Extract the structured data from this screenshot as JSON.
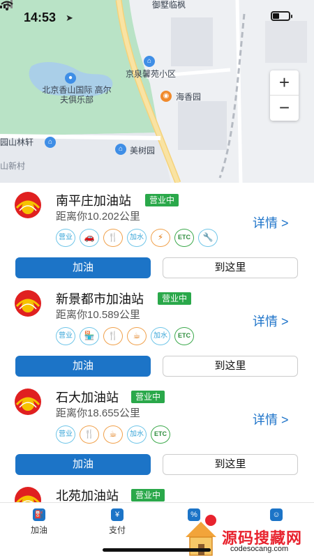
{
  "status_bar": {
    "time": "14:53"
  },
  "map": {
    "labels": {
      "top": "御墅临枫",
      "complex": "京泉馨苑小区",
      "golf": "北京香山国际\n高尔夫俱乐部",
      "park": "海香园",
      "linxuan": "园山林轩",
      "meishu": "美树园",
      "village": "山新村"
    },
    "zoom_in": "+",
    "zoom_out": "−"
  },
  "stations": [
    {
      "name": "南平庄加油站",
      "status": "营业中",
      "distance": "距离你10.202公里",
      "detail": "详情 >",
      "tags": [
        {
          "label": "营业",
          "style": "blue"
        },
        {
          "label": "洗车",
          "style": "blue",
          "icon": "car-wash-icon"
        },
        {
          "label": "餐",
          "style": "orange",
          "icon": "cutlery-icon"
        },
        {
          "label": "加水",
          "style": "blue"
        },
        {
          "label": "充",
          "style": "orange",
          "icon": "charging-icon"
        },
        {
          "label": "ETC",
          "style": "green"
        },
        {
          "label": "修",
          "style": "blue",
          "icon": "maintenance-icon"
        }
      ],
      "btn_fuel": "加油",
      "btn_go": "到这里"
    },
    {
      "name": "新景都市加油站",
      "status": "营业中",
      "distance": "距离你10.589公里",
      "detail": "详情 >",
      "tags": [
        {
          "label": "营业",
          "style": "blue"
        },
        {
          "label": "店",
          "style": "blue",
          "icon": "store-icon"
        },
        {
          "label": "餐",
          "style": "orange",
          "icon": "cutlery-icon"
        },
        {
          "label": "饮",
          "style": "orange",
          "icon": "coffee-icon"
        },
        {
          "label": "加水",
          "style": "blue"
        },
        {
          "label": "ETC",
          "style": "green"
        }
      ],
      "btn_fuel": "加油",
      "btn_go": "到这里"
    },
    {
      "name": "石大加油站",
      "status": "营业中",
      "distance": "距离你18.655公里",
      "detail": "详情 >",
      "tags": [
        {
          "label": "营业",
          "style": "blue"
        },
        {
          "label": "餐",
          "style": "orange",
          "icon": "cutlery-icon"
        },
        {
          "label": "饮",
          "style": "orange",
          "icon": "coffee-icon"
        },
        {
          "label": "加水",
          "style": "blue"
        },
        {
          "label": "ETC",
          "style": "green"
        }
      ],
      "btn_fuel": "加油",
      "btn_go": "到这里"
    },
    {
      "name": "北苑加油站",
      "status": "营业中",
      "distance": "",
      "detail": "",
      "tags": [],
      "btn_fuel": "",
      "btn_go": ""
    }
  ],
  "tabbar": {
    "tab1": "加油",
    "tab2": "支付"
  },
  "watermark": {
    "text": "源码搜藏网",
    "url": "codesocang.com"
  },
  "colors": {
    "primary": "#1c74c7",
    "open_badge": "#2aa84a",
    "link": "#1d73c9"
  }
}
